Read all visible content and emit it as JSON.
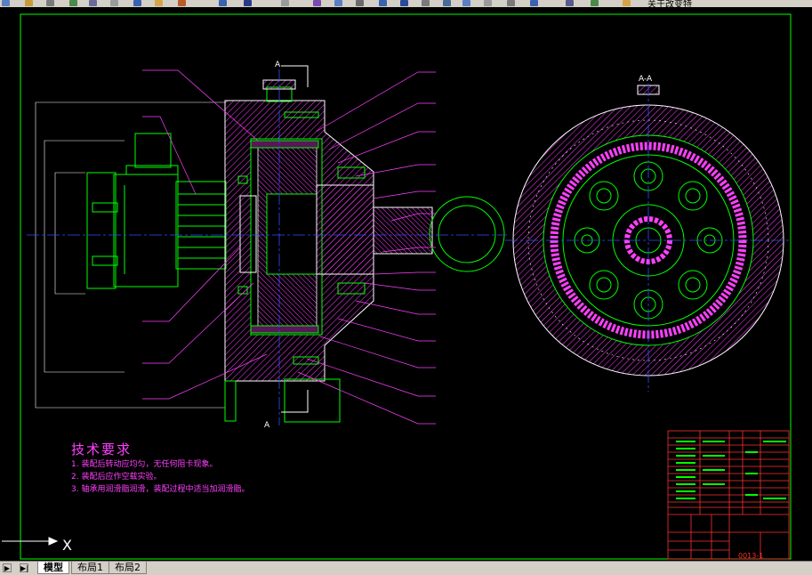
{
  "toolbar": {
    "visible_text": "关于改变特"
  },
  "drawing": {
    "section_label_top": "A",
    "section_label_bottom": "A",
    "section_view_label": "A-A",
    "tech_requirements": {
      "title": "技术要求",
      "lines": [
        "1. 装配后转动应均匀，无任何阻卡现象。",
        "2. 装配后应作空载实验。",
        "3. 轴承用润滑脂润滑，装配过程中适当加润滑脂。"
      ]
    },
    "ucs_axis_label": "X",
    "drawing_number": "0013-1"
  },
  "layout_tabs": {
    "nav": [
      "▶",
      "▶|"
    ],
    "tabs": [
      {
        "label": "模型",
        "active": true
      },
      {
        "label": "布局1",
        "active": false
      },
      {
        "label": "布局2",
        "active": false
      }
    ]
  },
  "colors": {
    "background": "#000000",
    "frame": "#00ff00",
    "hatch": "#ff40ff",
    "outline": "#ffffff",
    "centerline": "#3050ff",
    "leader": "#ff40ff",
    "title_block": "#ff3030"
  }
}
